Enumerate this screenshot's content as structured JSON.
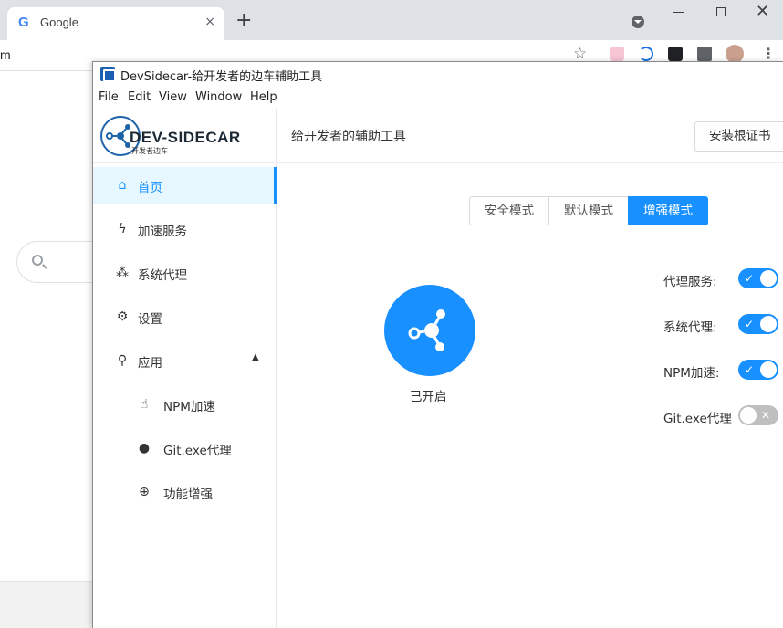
{
  "browser": {
    "tab_title": "Google",
    "tab_favicon": "G",
    "tab_close": "×",
    "new_tab": "+",
    "omnibox_text": "m",
    "star": "☆",
    "menu": "⋮",
    "window_close": "✕"
  },
  "app": {
    "title": "DevSidecar-给开发者的边车辅助工具",
    "menu": [
      "File",
      "Edit",
      "View",
      "Window",
      "Help"
    ],
    "logo_text": "DEV-SIDECAR",
    "logo_subtext": "开发者边车"
  },
  "sidebar": {
    "items": [
      {
        "label": "首页",
        "icon": "home-icon",
        "glyph": "⌂"
      },
      {
        "label": "加速服务",
        "icon": "lightning-icon",
        "glyph": "ϟ"
      },
      {
        "label": "系统代理",
        "icon": "network-icon",
        "glyph": "⁂"
      },
      {
        "label": "设置",
        "icon": "gear-icon",
        "glyph": "⚙"
      },
      {
        "label": "应用",
        "icon": "rocket-icon",
        "glyph": "⚲",
        "arrow": "▲"
      },
      {
        "label": "NPM加速",
        "icon": "thumbs-up-icon",
        "glyph": "☝"
      },
      {
        "label": "Git.exe代理",
        "icon": "github-icon",
        "glyph": "●"
      },
      {
        "label": "功能增强",
        "icon": "globe-icon",
        "glyph": "⊕"
      }
    ]
  },
  "header": {
    "title": "给开发者的辅助工具",
    "cert_button": "安装根证书"
  },
  "modes": {
    "options": [
      "安全模式",
      "默认模式",
      "增强模式"
    ],
    "selected": "增强模式"
  },
  "main": {
    "status": "已开启"
  },
  "toggles": [
    {
      "label": "代理服务:",
      "on": true,
      "mark": "✓"
    },
    {
      "label": "系统代理:",
      "on": true,
      "mark": "✓"
    },
    {
      "label": "NPM加速:",
      "on": true,
      "mark": "✓"
    },
    {
      "label": "Git.exe代理",
      "on": false,
      "mark": "✕"
    }
  ],
  "colors": {
    "primary": "#1890ff",
    "switch_off": "#bfbfbf",
    "active_bg": "#e6f7ff"
  }
}
